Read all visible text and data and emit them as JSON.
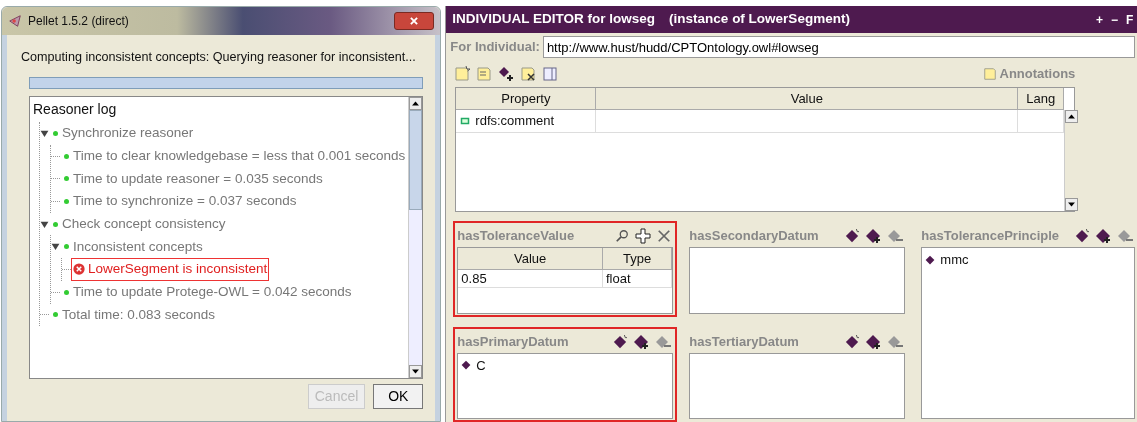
{
  "dialog": {
    "title": "Pellet 1.5.2 (direct)",
    "message": "Computing inconsistent concepts: Querying reasoner for inconsistent...",
    "progress": {
      "level": 0
    },
    "log": {
      "title": "Reasoner log",
      "items": [
        {
          "kind": "info",
          "text": "Synchronize reasoner",
          "expanded": true,
          "children": [
            {
              "kind": "info",
              "text": "Time to clear knowledgebase = less that 0.001 seconds"
            },
            {
              "kind": "info",
              "text": "Time to update reasoner = 0.035 seconds"
            },
            {
              "kind": "info",
              "text": "Time to synchronize = 0.037 seconds"
            }
          ]
        },
        {
          "kind": "info",
          "text": "Check concept consistency",
          "expanded": true,
          "children": [
            {
              "kind": "info",
              "text": "Inconsistent concepts",
              "expanded": true,
              "children": [
                {
                  "kind": "error",
                  "text": "LowerSegment is inconsistent",
                  "highlighted": true
                }
              ]
            },
            {
              "kind": "info",
              "text": "Time to update Protege-OWL = 0.042 seconds"
            }
          ]
        },
        {
          "kind": "info",
          "text": "Total time: 0.083 seconds"
        }
      ]
    },
    "buttons": [
      {
        "label": "Cancel",
        "disabled": true
      },
      {
        "label": "OK",
        "disabled": false
      }
    ]
  },
  "editor": {
    "title": "INDIVIDUAL EDITOR for lowseg",
    "subtitle": "(instance of LowerSegment)",
    "header_buttons": [
      "+",
      "−",
      "F"
    ],
    "for_individual": {
      "label": "For Individual:",
      "value": "http://www.hust/hudd/CPTOntology.owl#lowseg"
    },
    "annotations_label": "Annotations",
    "table": {
      "columns": [
        "Property",
        "Value",
        "Lang"
      ],
      "rows": [
        {
          "property": "rdfs:comment",
          "value": "",
          "lang": ""
        }
      ]
    },
    "panel_columns": [
      [
        {
          "title": "hasToleranceValue",
          "kind": "table",
          "highlighted": true,
          "columns": [
            "Value",
            "Type"
          ],
          "rows": [
            [
              "0.85",
              "float"
            ]
          ]
        },
        {
          "title": "hasPrimaryDatum",
          "kind": "list",
          "highlighted": true,
          "items": [
            "C"
          ]
        }
      ],
      [
        {
          "title": "hasSecondaryDatum",
          "kind": "list",
          "highlighted": false
        },
        {
          "title": "hasTertiaryDatum",
          "kind": "list",
          "highlighted": false
        }
      ],
      [
        {
          "title": "hasTolerancePrinciple",
          "kind": "list",
          "highlighted": false,
          "items": [
            "mmc"
          ]
        }
      ]
    ]
  }
}
